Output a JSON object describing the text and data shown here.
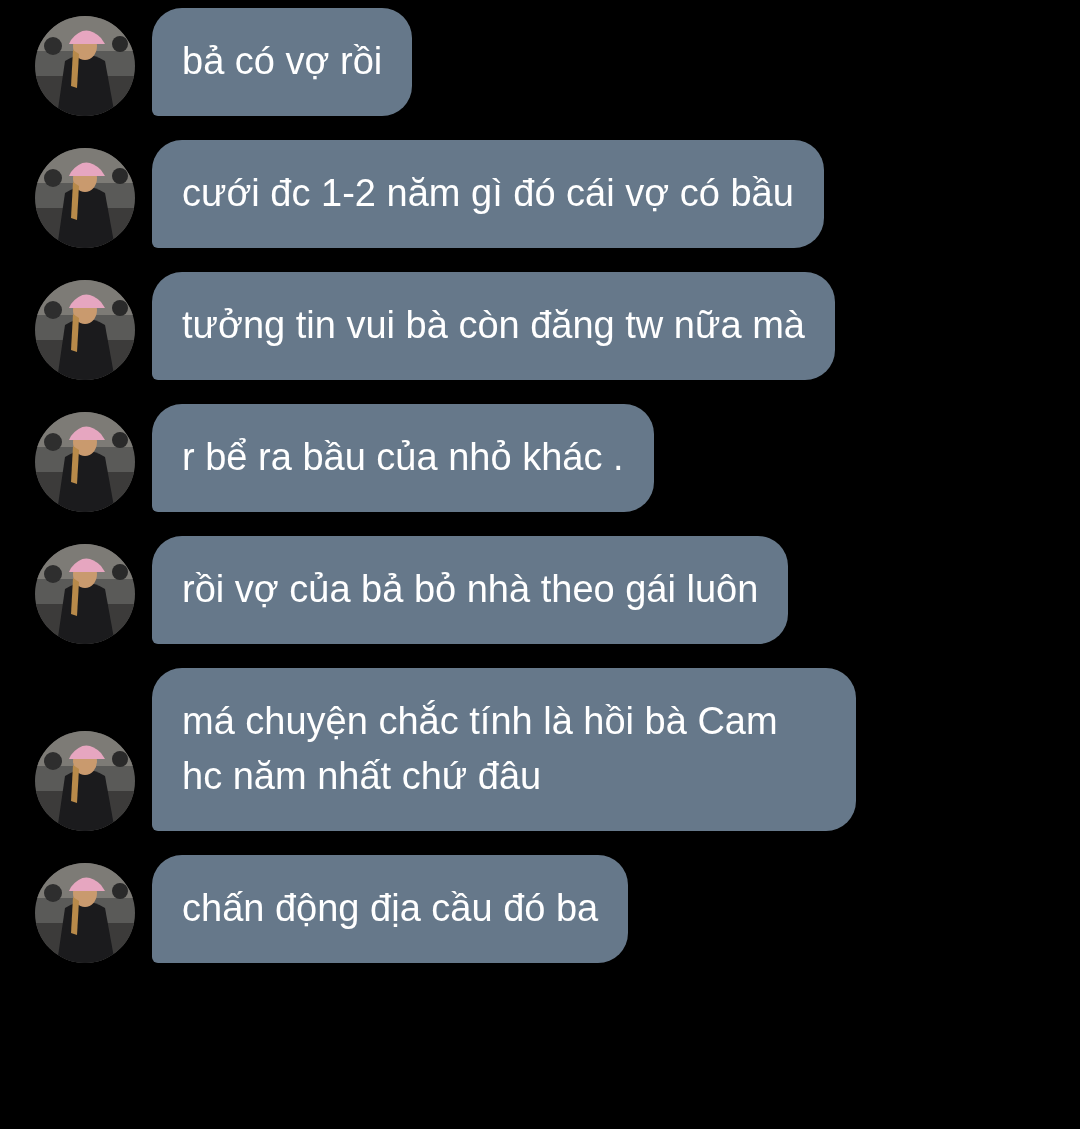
{
  "messages": [
    {
      "text": "bả có vợ rồi"
    },
    {
      "text": "cưới đc 1-2 năm gì đó cái vợ có bầu"
    },
    {
      "text": "tưởng tin vui bà còn đăng tw nữa mà"
    },
    {
      "text": "r bể ra bầu của nhỏ khác ."
    },
    {
      "text": "rồi vợ của bả bỏ nhà theo gái luôn"
    },
    {
      "text": "má chuyện chắc tính là hồi bà Cam hc năm nhất chứ đâu"
    },
    {
      "text": "chấn động địa cầu đó ba"
    }
  ]
}
